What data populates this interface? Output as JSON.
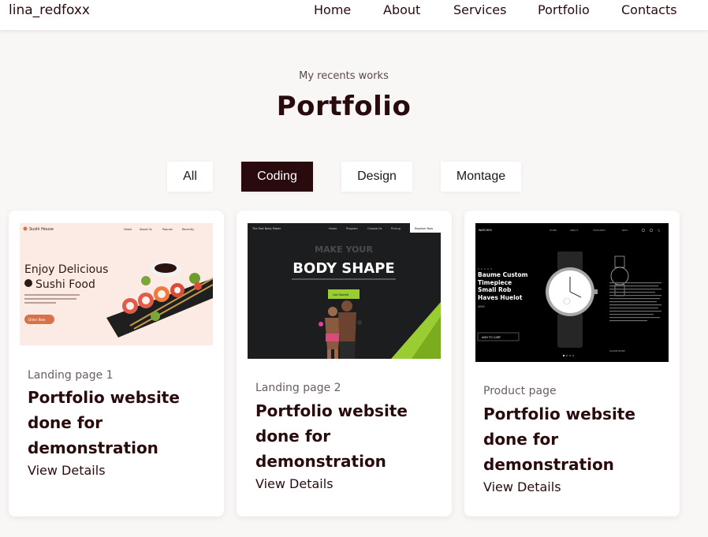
{
  "nav": {
    "logo": "lina_redfoxx",
    "links": [
      "Home",
      "About",
      "Services",
      "Portfolio",
      "Contacts"
    ]
  },
  "section": {
    "subtitle": "My recents works",
    "title": "Portfolio"
  },
  "filters": {
    "items": [
      "All",
      "Coding",
      "Design",
      "Montage"
    ],
    "active": "Coding"
  },
  "colors": {
    "brand": "#2a0b0d",
    "accent_sushi": "#d9724a",
    "accent_fitness": "#9acd32"
  },
  "cards": [
    {
      "category": "Landing page 1",
      "title": "Portfolio website done for demonstration",
      "link": "View Details",
      "thumb": {
        "brand": "Sushi House",
        "menu": [
          "Home",
          "About Us",
          "Popular",
          "Recently"
        ],
        "headline_1": "Enjoy Delicious",
        "headline_2": "Sushi Food",
        "button": "Order Now",
        "icon": "sushi-icon"
      }
    },
    {
      "category": "Landing page 2",
      "title": "Portfolio website done for demonstration",
      "link": "View Details",
      "thumb": {
        "brand": "The Fast Body Maker",
        "menu": [
          "Home",
          "Program",
          "Choose Us",
          "Pricing"
        ],
        "cta_top": "Register Now",
        "headline_1": "MAKE YOUR",
        "headline_2": "BODY SHAPE",
        "button": "Get Started"
      }
    },
    {
      "category": "Product page",
      "title": "Portfolio website done for demonstration",
      "link": "View Details",
      "thumb": {
        "brand": "WATCHES",
        "menu": [
          "HOME",
          "ABOUT",
          "FEATURED",
          "NEW"
        ],
        "product_name": "Baume Custom Timepiece Small Rob Haves Huelot",
        "price": "$660",
        "button": "ADD TO CART",
        "learn_more": "LEARN MORE"
      }
    }
  ]
}
